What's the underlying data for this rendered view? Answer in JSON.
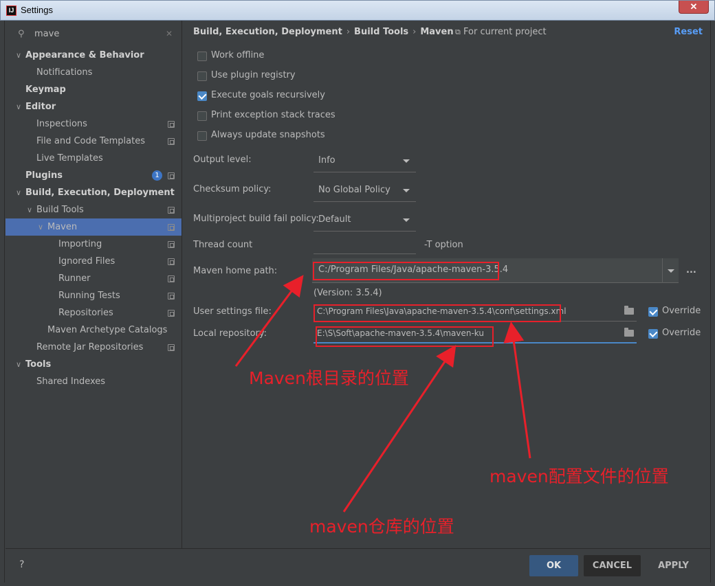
{
  "window": {
    "title": "Settings",
    "close_label": "✕"
  },
  "search": {
    "value": "mave",
    "icon": "search-icon",
    "clear": "✕"
  },
  "sidebar": {
    "items": [
      {
        "label": "Appearance & Behavior",
        "level": 0,
        "arrow": "∨",
        "bold": true,
        "project_icon": false
      },
      {
        "label": "Notifications",
        "level": 1,
        "arrow": "",
        "bold": false,
        "project_icon": false
      },
      {
        "label": "Keymap",
        "level": 0,
        "arrow": "",
        "bold": true,
        "project_icon": false
      },
      {
        "label": "Editor",
        "level": 0,
        "arrow": "∨",
        "bold": true,
        "project_icon": false
      },
      {
        "label": "Inspections",
        "level": 1,
        "arrow": "",
        "bold": false,
        "project_icon": true
      },
      {
        "label": "File and Code Templates",
        "level": 1,
        "arrow": "",
        "bold": false,
        "project_icon": true
      },
      {
        "label": "Live Templates",
        "level": 1,
        "arrow": "",
        "bold": false,
        "project_icon": false
      },
      {
        "label": "Plugins",
        "level": 0,
        "arrow": "",
        "bold": true,
        "project_icon": true,
        "badge": "1"
      },
      {
        "label": "Build, Execution, Deployment",
        "level": 0,
        "arrow": "∨",
        "bold": true,
        "project_icon": false
      },
      {
        "label": "Build Tools",
        "level": 1,
        "arrow": "∨",
        "bold": false,
        "project_icon": true
      },
      {
        "label": "Maven",
        "level": 2,
        "arrow": "∨",
        "bold": false,
        "project_icon": true,
        "selected": true
      },
      {
        "label": "Importing",
        "level": 3,
        "arrow": "",
        "bold": false,
        "project_icon": true
      },
      {
        "label": "Ignored Files",
        "level": 3,
        "arrow": "",
        "bold": false,
        "project_icon": true
      },
      {
        "label": "Runner",
        "level": 3,
        "arrow": "",
        "bold": false,
        "project_icon": true
      },
      {
        "label": "Running Tests",
        "level": 3,
        "arrow": "",
        "bold": false,
        "project_icon": true
      },
      {
        "label": "Repositories",
        "level": 3,
        "arrow": "",
        "bold": false,
        "project_icon": true
      },
      {
        "label": "Maven Archetype Catalogs",
        "level": 2,
        "arrow": "",
        "bold": false,
        "project_icon": false
      },
      {
        "label": "Remote Jar Repositories",
        "level": 1,
        "arrow": "",
        "bold": false,
        "project_icon": true
      },
      {
        "label": "Tools",
        "level": 0,
        "arrow": "∨",
        "bold": true,
        "project_icon": false
      },
      {
        "label": "Shared Indexes",
        "level": 1,
        "arrow": "",
        "bold": false,
        "project_icon": false
      }
    ]
  },
  "header": {
    "breadcrumb": [
      "Build, Execution, Deployment",
      "Build Tools",
      "Maven"
    ],
    "breadcrumb_sep": "›",
    "for_project": "For current project",
    "reset": "Reset"
  },
  "checkboxes": [
    {
      "label": "Work offline",
      "checked": false
    },
    {
      "label": "Use plugin registry",
      "checked": false
    },
    {
      "label": "Execute goals recursively",
      "checked": true
    },
    {
      "label": "Print exception stack traces",
      "checked": false
    },
    {
      "label": "Always update snapshots",
      "checked": false
    }
  ],
  "fields": {
    "output_level": {
      "label": "Output level:",
      "value": "Info"
    },
    "checksum_policy": {
      "label": "Checksum policy:",
      "value": "No Global Policy"
    },
    "multiproject_fail": {
      "label": "Multiproject build fail policy:",
      "value": "Default"
    },
    "thread_count": {
      "label": "Thread count",
      "value": "",
      "suffix": "-T option"
    },
    "maven_home": {
      "label": "Maven home path:",
      "value": "C:/Program Files/Java/apache-maven-3.5.4",
      "ellipsis": "..."
    },
    "version": "(Version: 3.5.4)",
    "user_settings": {
      "label": "User settings file:",
      "value": "C:\\Program Files\\Java\\apache-maven-3.5.4\\conf\\settings.xml",
      "override": "Override",
      "override_checked": true
    },
    "local_repo": {
      "label": "Local repository:",
      "value": "E:\\S\\Soft\\apache-maven-3.5.4\\maven-ku",
      "override": "Override",
      "override_checked": true
    }
  },
  "annotations": {
    "home": "Maven根目录的位置",
    "settings": "maven配置文件的位置",
    "repo": "maven仓库的位置",
    "color": "#e8202a"
  },
  "footer": {
    "help": "?",
    "ok": "OK",
    "cancel": "CANCEL",
    "apply": "APPLY"
  },
  "colors": {
    "background": "#3c3f41",
    "selection": "#4b6eaf",
    "link": "#589df6",
    "primary_button": "#365880",
    "checkbox_checked": "#4a88c7"
  }
}
